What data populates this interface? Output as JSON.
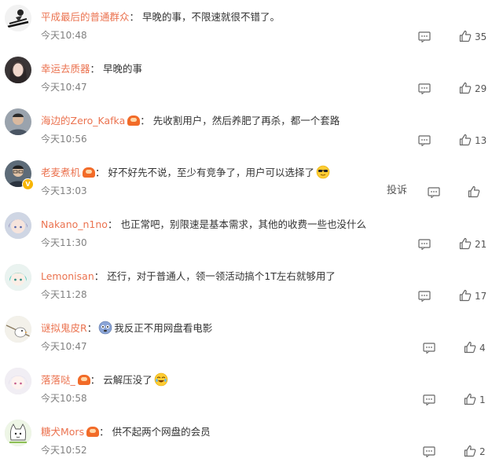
{
  "comments": [
    {
      "username": "平成最后的普通群众",
      "vip": false,
      "verified": false,
      "colon": "：",
      "text": "早晚的事，不限速就很不错了。",
      "time": "今天10:48",
      "likes": "35",
      "avatar_icon": "skier-cartoon-avatar"
    },
    {
      "username": "幸运去质器",
      "vip": false,
      "verified": false,
      "colon": "：",
      "text": "早晚的事",
      "time": "今天10:47",
      "likes": "29",
      "avatar_icon": "girl-photo-avatar"
    },
    {
      "username": "海边的Zero_Kafka",
      "vip": true,
      "verified": false,
      "colon": "：",
      "text": "先收割用户，然后养肥了再杀，都一个套路",
      "time": "今天10:56",
      "likes": "13",
      "avatar_icon": "man-photo-avatar"
    },
    {
      "username": "老麦煮机",
      "vip": true,
      "verified": true,
      "colon": "：",
      "text": "好不好先不说，至少有竞争了，用户可以选择了",
      "emoji": "sunglasses-emoji",
      "time": "今天13:03",
      "report": "投诉",
      "likes": "",
      "avatar_icon": "man-glasses-avatar"
    },
    {
      "username": "Nakano_n1no",
      "vip": false,
      "verified": false,
      "colon": "：",
      "text": "也正常吧，别限速是基本需求，其他的收费一些也没什么",
      "time": "今天11:30",
      "likes": "21",
      "avatar_icon": "anime-girl-avatar"
    },
    {
      "username": "Lemonisan",
      "vip": false,
      "verified": false,
      "colon": "：",
      "text": "还行，对于普通人，领一领活动搞个1T左右就够用了",
      "time": "今天11:28",
      "likes": "17",
      "avatar_icon": "anime-character-avatar"
    },
    {
      "username": "谜拟鬼皮R",
      "vip": false,
      "verified": false,
      "colon": "：",
      "lead_emoji": "dizzy-emoji",
      "text": "我反正不用网盘看电影",
      "time": "今天10:47",
      "likes": "4",
      "avatar_icon": "cartoon-bird-avatar"
    },
    {
      "username": "落落哒_",
      "vip": true,
      "verified": false,
      "colon": "：",
      "text": "云解压没了",
      "emoji": "crying-laugh-emoji",
      "time": "今天10:58",
      "likes": "1",
      "avatar_icon": "anime-white-avatar"
    },
    {
      "username": "糖犬Mors",
      "vip": true,
      "verified": false,
      "colon": "：",
      "text": "供不起两个网盘的会员",
      "time": "今天10:52",
      "likes": "2",
      "avatar_icon": "cartoon-cat-avatar"
    }
  ],
  "colors": {
    "username": "#eb7350",
    "text": "#333333",
    "time": "#808080",
    "vip": "#f26b28",
    "verified": "#f7b500"
  }
}
